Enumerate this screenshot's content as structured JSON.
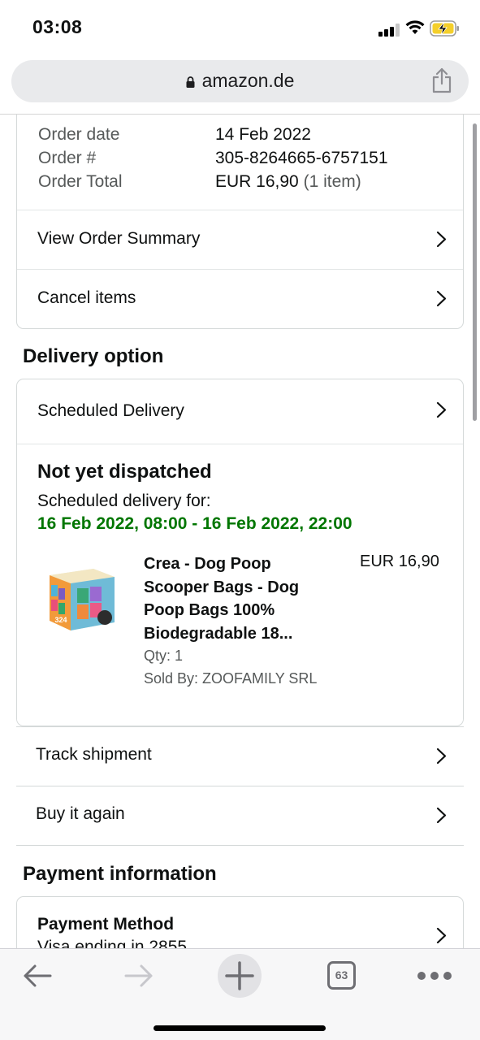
{
  "status_bar": {
    "time": "03:08"
  },
  "browser": {
    "url": "amazon.de",
    "tab_count": "63"
  },
  "order": {
    "date_label": "Order date",
    "date_value": "14 Feb 2022",
    "number_label": "Order #",
    "number_value": "305-8264665-6757151",
    "total_label": "Order Total",
    "total_value": "EUR 16,90",
    "total_items": "(1 item)",
    "links": [
      "View Order Summary",
      "Cancel items"
    ]
  },
  "delivery": {
    "section_title": "Delivery option",
    "option_label": "Scheduled Delivery",
    "status": "Not yet dispatched",
    "scheduled_for_label": "Scheduled delivery for:",
    "scheduled_window": "16 Feb 2022, 08:00 - 16 Feb 2022, 22:00",
    "product": {
      "title": "Crea - Dog Poop Scooper Bags - Dog Poop Bags 100% Biodegradable 18...",
      "price": "EUR 16,90",
      "qty": "Qty: 1",
      "seller": "Sold By: ZOOFAMILY SRL",
      "image_text": "324"
    }
  },
  "actions": [
    "Track shipment",
    "Buy it again"
  ],
  "payment": {
    "section_title": "Payment information",
    "method_label": "Payment Method",
    "method_value": "Visa ending in 2855"
  },
  "colors": {
    "accent_green": "#007600",
    "border": "#d5d9d9",
    "muted_text": "#565959"
  }
}
